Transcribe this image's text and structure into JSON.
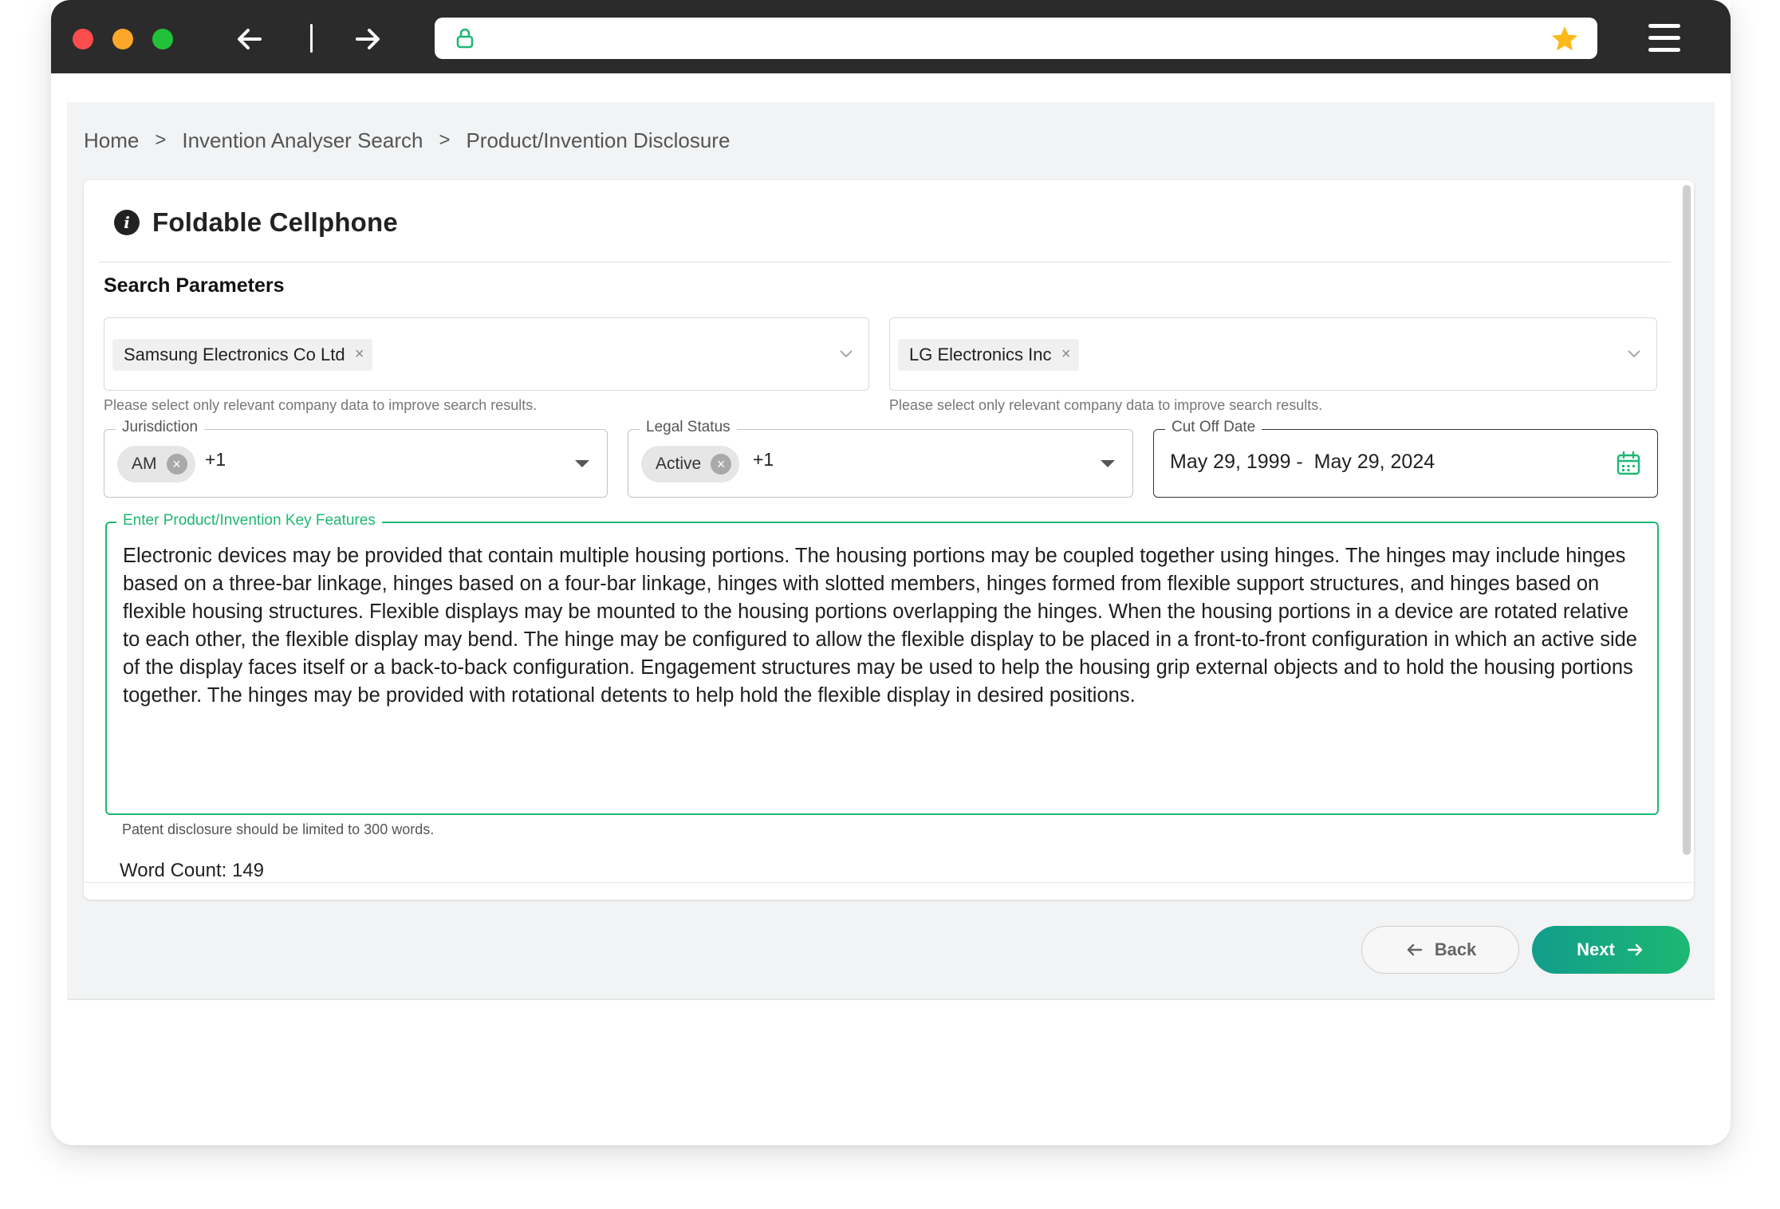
{
  "browser": {
    "url": "",
    "icons": {
      "back": "arrow-left-icon",
      "forward": "arrow-right-icon",
      "lock": "lock-icon",
      "bookmark": "star-icon",
      "menu": "hamburger-menu-icon"
    },
    "colors": {
      "chrome": "#2b2b2b",
      "close": "#fe4d4e",
      "minimize": "#fba72a",
      "maximize": "#22c13a",
      "lock": "#1db872",
      "star": "#fbb91a"
    }
  },
  "breadcrumb": {
    "items": [
      "Home",
      "Invention Analyser Search",
      "Product/Invention Disclosure"
    ],
    "separator": ">"
  },
  "card": {
    "title": "Foldable Cellphone",
    "section_title": "Search Parameters",
    "company_left": {
      "tag": "Samsung Electronics Co Ltd",
      "helper": "Please select only relevant company data to improve search results."
    },
    "company_right": {
      "tag": "LG Electronics Inc",
      "helper": "Please select only relevant company data to improve search results."
    },
    "jurisdiction": {
      "label": "Jurisdiction",
      "chip": "AM",
      "more": "+1"
    },
    "legal_status": {
      "label": "Legal Status",
      "chip": "Active",
      "more": "+1"
    },
    "cutoff": {
      "label": "Cut Off Date",
      "value": "May 29, 1999 -  May 29, 2024"
    },
    "features": {
      "label": "Enter Product/Invention Key Features",
      "text": "Electronic devices may be provided that contain multiple housing portions. The housing portions may be coupled together using hinges. The hinges may include hinges based on a three-bar linkage, hinges based on a four-bar linkage, hinges with slotted members, hinges formed from flexible support structures, and hinges based on flexible housing structures. Flexible displays may be mounted to the housing portions overlapping the hinges. When the housing portions in a device are rotated relative to each other, the flexible display may bend. The hinge may be configured to allow the flexible display to be placed in a front-to-front configuration in which an active side of the display faces itself or a back-to-back configuration. Engagement structures may be used to help the housing grip external objects and to hold the housing portions together. The hinges may be provided with rotational detents to help hold the flexible display in desired positions.",
      "limit_note": "Patent disclosure should be limited to 300 words.",
      "word_count": "Word Count: 149"
    },
    "accent_color": "#1db872"
  },
  "footer": {
    "back_label": "Back",
    "next_label": "Next"
  }
}
